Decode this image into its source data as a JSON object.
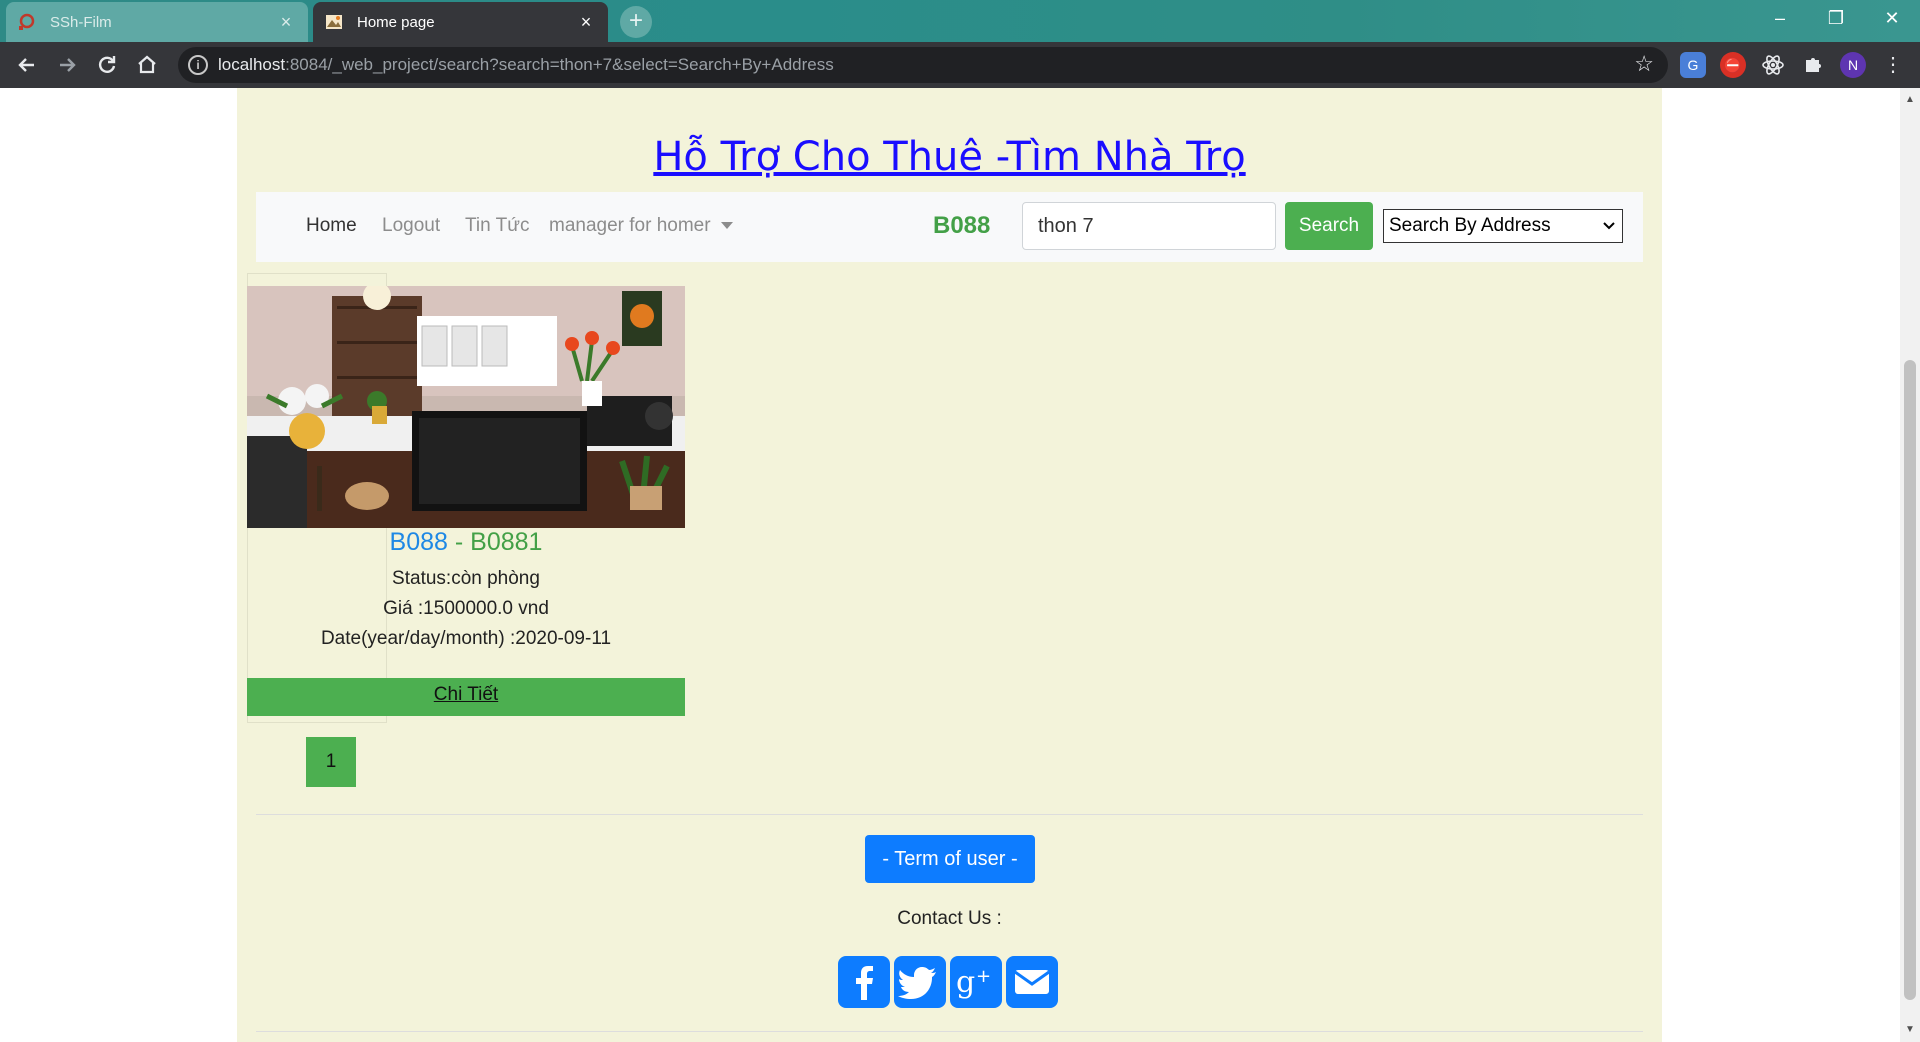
{
  "browser": {
    "tabs": [
      {
        "title": "SSh-Film",
        "close": "×"
      },
      {
        "title": "Home page",
        "close": "×"
      }
    ],
    "new_tab": "+",
    "window_controls": {
      "minimize": "–",
      "maximize": "❐",
      "close": "✕"
    },
    "url": {
      "host": "localhost",
      "rest": ":8084/_web_project/search?search=thon+7&select=Search+By+Address"
    },
    "profile_initial": "N",
    "nav_icons": [
      "back-icon",
      "forward-icon",
      "reload-icon",
      "home-icon"
    ],
    "extension_icons": [
      "translate-icon",
      "adblock-icon",
      "react-devtools-icon",
      "extensions-puzzle-icon"
    ]
  },
  "site": {
    "title": "Hỗ Trợ Cho Thuê -Tìm Nhà Trọ"
  },
  "nav": {
    "home": "Home",
    "logout": "Logout",
    "news": "Tin Tức",
    "manager": "manager for homer",
    "user": "B088",
    "search_value": "thon 7",
    "search_button": "Search",
    "select_value": "Search By Address"
  },
  "listing": {
    "code": "B088",
    "separator": " - ",
    "room": "B0881",
    "status": "Status:còn phòng",
    "price": "Giá :1500000.0 vnd",
    "date": "Date(year/day/month) :2020-09-11",
    "detail_link": "Chi Tiết"
  },
  "pagination": {
    "current": "1"
  },
  "footer": {
    "terms": "- Term of user -",
    "contact": "Contact Us :",
    "social_icons": [
      "facebook-icon",
      "twitter-icon",
      "google-plus-icon",
      "email-icon"
    ]
  },
  "colors": {
    "page_bg": "#f3f3da",
    "accent_green": "#4caf50",
    "link_blue": "#1a0dff",
    "primary_blue": "#0d7cff"
  }
}
